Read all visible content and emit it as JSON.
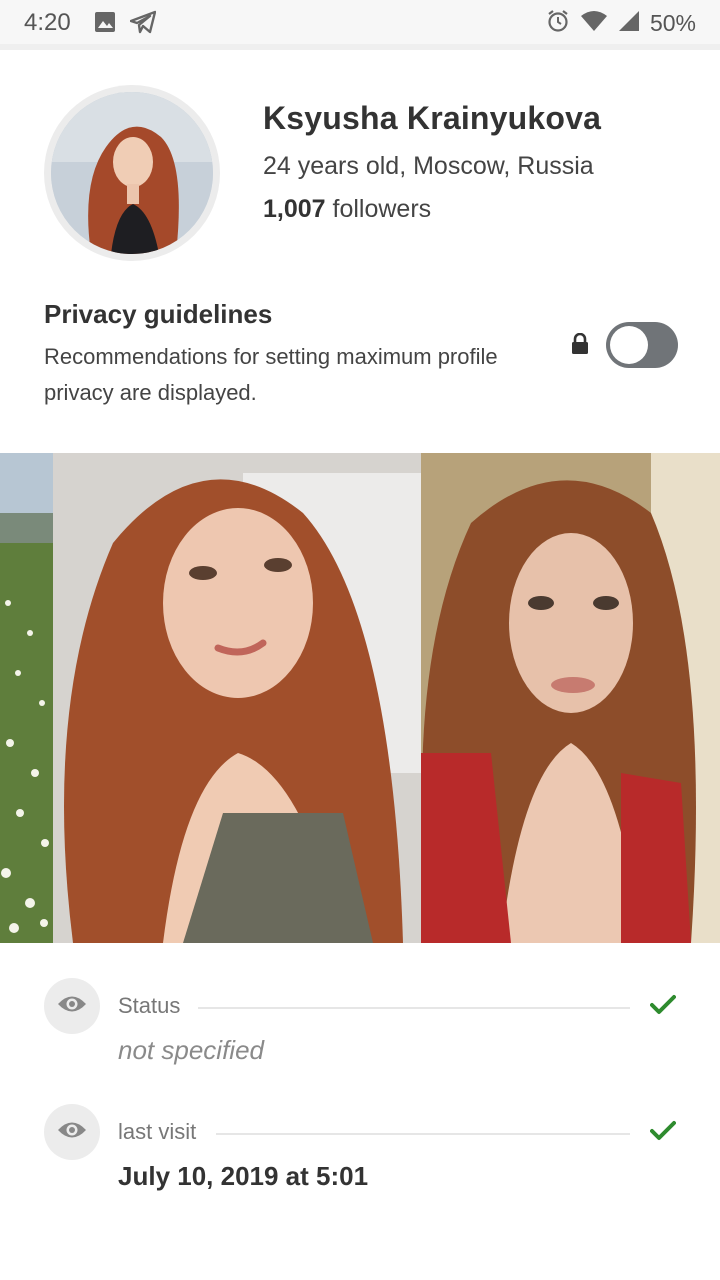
{
  "status_bar": {
    "time": "4:20",
    "battery": "50%",
    "icons": [
      "image-icon",
      "telegram-icon",
      "alarm-icon",
      "wifi-icon",
      "signal-icon",
      "battery-icon"
    ]
  },
  "profile": {
    "name": "Ksyusha Krainyukova",
    "details": "24 years old, Moscow, Russia",
    "followers_count": "1,007",
    "followers_label": " followers"
  },
  "privacy": {
    "title": "Privacy guidelines",
    "description": "Recommendations for setting maximum profile privacy are displayed.",
    "toggle_on": false
  },
  "gallery": {
    "photos": [
      "photo-landscape",
      "photo-selfie-1",
      "photo-selfie-2"
    ]
  },
  "info": [
    {
      "label": "Status",
      "value": "not specified",
      "verified": true
    },
    {
      "label": "last visit",
      "value": "July 10, 2019 at 5:01",
      "verified": true
    }
  ],
  "colors": {
    "check": "#2e8b2e",
    "toggle_off": "#707478",
    "icon_bg": "#ececec"
  }
}
